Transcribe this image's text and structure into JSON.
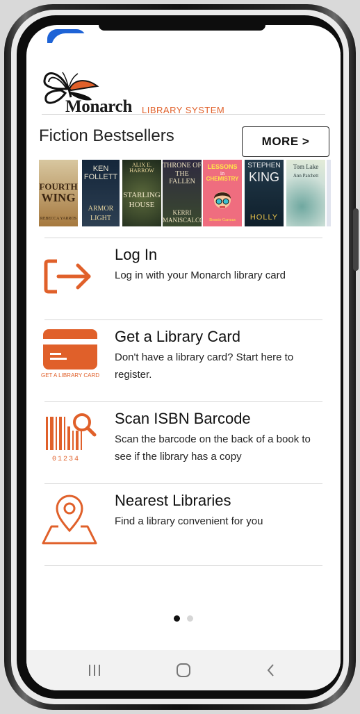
{
  "brand": {
    "name": "Monarch",
    "subtitle": "LIBRARY SYSTEM",
    "accent_color": "#e0602a"
  },
  "bestsellers": {
    "title": "Fiction Bestsellers",
    "more_label": "MORE >",
    "books": [
      {
        "lines": [
          "FOURTH",
          "WING",
          "REBECCA YARROS"
        ],
        "color": "#b8905a"
      },
      {
        "lines": [
          "KEN",
          "FOLLETT",
          "ARMOR",
          "LIGHT"
        ],
        "color": "#1d2b3a"
      },
      {
        "lines": [
          "ALIX E. HARROW",
          "STARLING",
          "HOUSE"
        ],
        "color": "#2e3a2a"
      },
      {
        "lines": [
          "THRONE OF",
          "THE FALLEN",
          "KERRI",
          "MANISCALCO"
        ],
        "color": "#2a2436"
      },
      {
        "lines": [
          "LESSONS",
          "in",
          "CHEMISTRY",
          "Bonnie Garmus"
        ],
        "color": "#ef6d7f"
      },
      {
        "lines": [
          "STEPHEN",
          "KING",
          "HOLLY"
        ],
        "color": "#1f3a4a"
      },
      {
        "lines": [
          "Tom Lake",
          "Ann Patchett"
        ],
        "color": "#cfe0d8"
      }
    ]
  },
  "menu": [
    {
      "id": "login",
      "title": "Log In",
      "description": "Log in with your Monarch library card",
      "icon": "login-icon"
    },
    {
      "id": "card",
      "title": "Get a Library Card",
      "description": "Don't have a library card? Start here to register.",
      "icon": "library-card-icon",
      "icon_caption": "GET A LIBRARY CARD"
    },
    {
      "id": "scan",
      "title": "Scan ISBN Barcode",
      "description": "Scan the barcode on the back of a book to see if the library has a copy",
      "icon": "barcode-scan-icon",
      "icon_caption": "01234"
    },
    {
      "id": "nearest",
      "title": "Nearest Libraries",
      "description": "Find a library convenient for you",
      "icon": "map-pin-icon"
    }
  ],
  "pager": {
    "count": 2,
    "active": 0
  },
  "nav": {
    "recent": "recent-apps-icon",
    "home": "home-icon",
    "back": "back-icon"
  }
}
